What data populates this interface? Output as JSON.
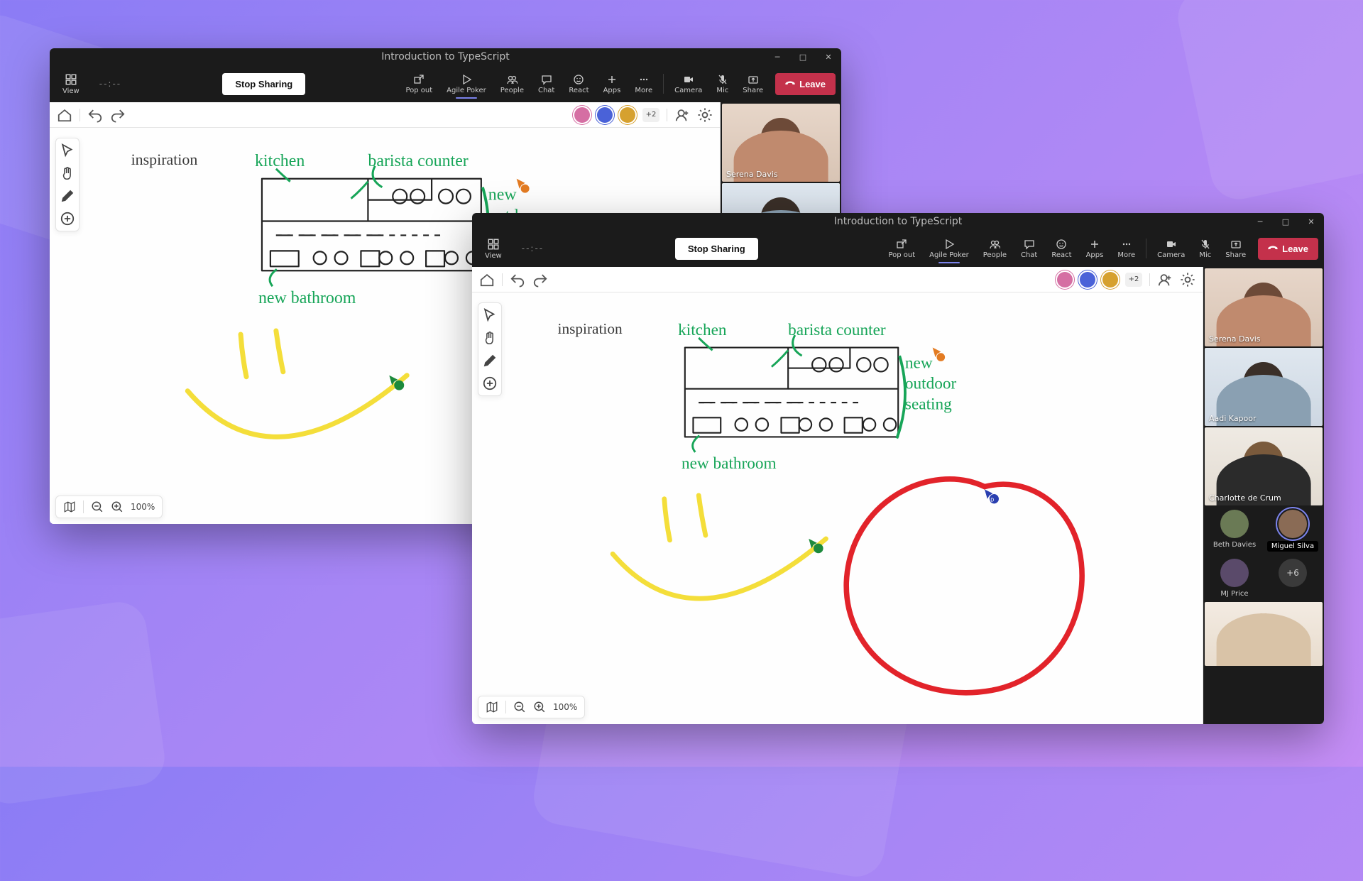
{
  "colors": {
    "accent": "#7b83eb",
    "danger": "#c4314b",
    "speaking": "#f2a93b"
  },
  "window": {
    "title": "Introduction to TypeScript",
    "timer": "--:--",
    "view_label": "View",
    "stop_sharing": "Stop Sharing",
    "leave": "Leave",
    "tools": {
      "popout": "Pop out",
      "agile": "Agile Poker",
      "people": "People",
      "chat": "Chat",
      "react": "React",
      "apps": "Apps",
      "more": "More",
      "camera": "Camera",
      "mic": "Mic",
      "share": "Share"
    }
  },
  "canvas_bar": {
    "overflow_count": "+2"
  },
  "whiteboard": {
    "labels": {
      "inspiration": "inspiration",
      "kitchen": "kitchen",
      "barista": "barista counter",
      "bathroom": "new bathroom",
      "outdoor1": "new",
      "outdoor2": "outdoor",
      "outdoor3": "seating"
    },
    "zoom": "100%"
  },
  "roster": {
    "serena": "Serena Davis",
    "aadi": "Aadi Kapoor",
    "charlotte": "Charlotte de Crum",
    "beth": "Beth Davies",
    "miguel": "Miguel Silva",
    "mj": "MJ Price",
    "overflow": "+6"
  }
}
